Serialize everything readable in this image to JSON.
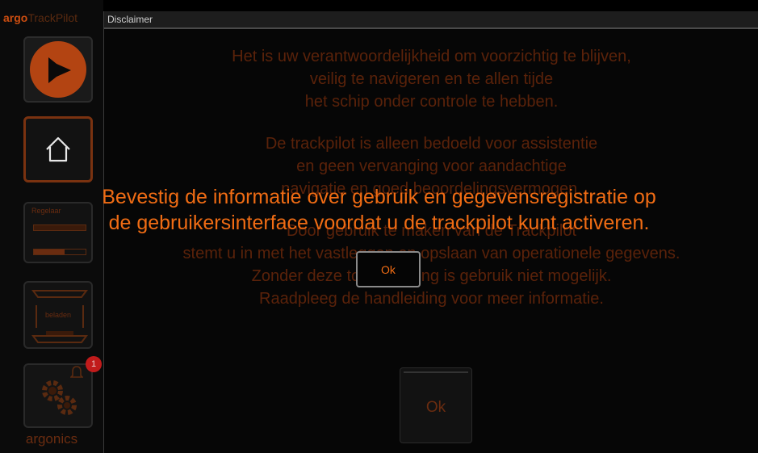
{
  "brand": {
    "part1": "argo",
    "part2": "TrackPilot"
  },
  "sidebar": {
    "play_icon": "play-arrow-icon",
    "home_icon": "home-icon",
    "level": {
      "label": "Regelaar",
      "fill_fraction": 0.6
    },
    "load": {
      "label": "beladen",
      "icon": "ship-load-icon"
    },
    "settings": {
      "icon": "gears-icon",
      "notification_count": "1",
      "bell_icon": "bell-icon"
    },
    "footer": "argonics"
  },
  "panel": {
    "title": "Disclaimer",
    "lines": [
      "Het is uw verantwoordelijkheid om voorzichtig te blijven,",
      "veilig te navigeren en te allen tijde",
      "het schip onder controle te hebben.",
      "De trackpilot is alleen bedoeld voor assistentie",
      "en geen vervanging voor aandachtige",
      "navigatie en goed beoordelingsvermogen.",
      "Door gebruik te maken van de Trackpilot",
      "stemt u in met het vastleggen en opslaan van operationele gegevens.",
      "Zonder deze toestemming is gebruik niet mogelijk.",
      "Raadpleeg de handleiding voor meer informatie."
    ],
    "ok_label": "Ok"
  },
  "overlay": {
    "line1": "Bevestig de informatie over gebruik en gegevensregistratie op",
    "line2": "de gebruikersinterface voordat u de trackpilot kunt activeren.",
    "ok_label": "Ok"
  },
  "colors": {
    "accent": "#f06c14",
    "dim_text": "#5a220a",
    "badge": "#c11b1b"
  }
}
